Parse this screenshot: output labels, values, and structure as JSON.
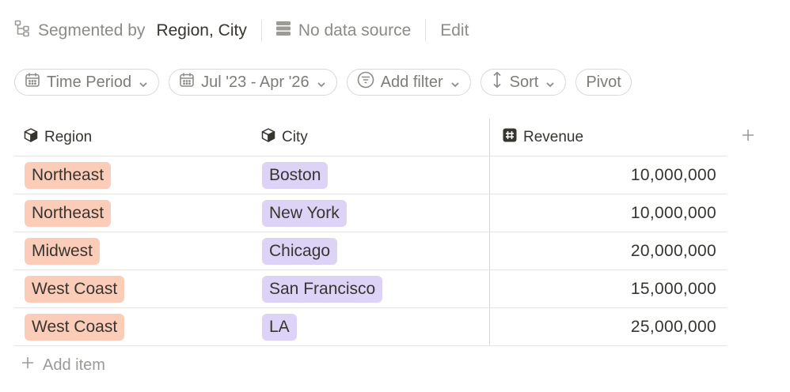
{
  "toolbar": {
    "segmented_label": "Segmented by",
    "segmented_value": "Region, City",
    "data_source": "No data source",
    "edit": "Edit"
  },
  "filters": {
    "time_period": "Time Period",
    "date_range": "Jul '23 - Apr '26",
    "add_filter": "Add filter",
    "sort": "Sort",
    "pivot": "Pivot"
  },
  "table": {
    "columns": [
      {
        "label": "Region",
        "icon": "cube-icon"
      },
      {
        "label": "City",
        "icon": "cube-icon"
      },
      {
        "label": "Revenue",
        "icon": "hash-icon"
      }
    ],
    "rows": [
      {
        "region": "Northeast",
        "city": "Boston",
        "revenue": "10,000,000"
      },
      {
        "region": "Northeast",
        "city": "New York",
        "revenue": "10,000,000"
      },
      {
        "region": "Midwest",
        "city": "Chicago",
        "revenue": "20,000,000"
      },
      {
        "region": "West Coast",
        "city": "San Francisco",
        "revenue": "15,000,000"
      },
      {
        "region": "West Coast",
        "city": "LA",
        "revenue": "25,000,000"
      }
    ]
  },
  "add_item": "Add item",
  "colors": {
    "region_tag": "#fbcdb8",
    "city_tag": "#ddd3f7",
    "muted_text": "#8c8b87",
    "text": "#37352f"
  }
}
